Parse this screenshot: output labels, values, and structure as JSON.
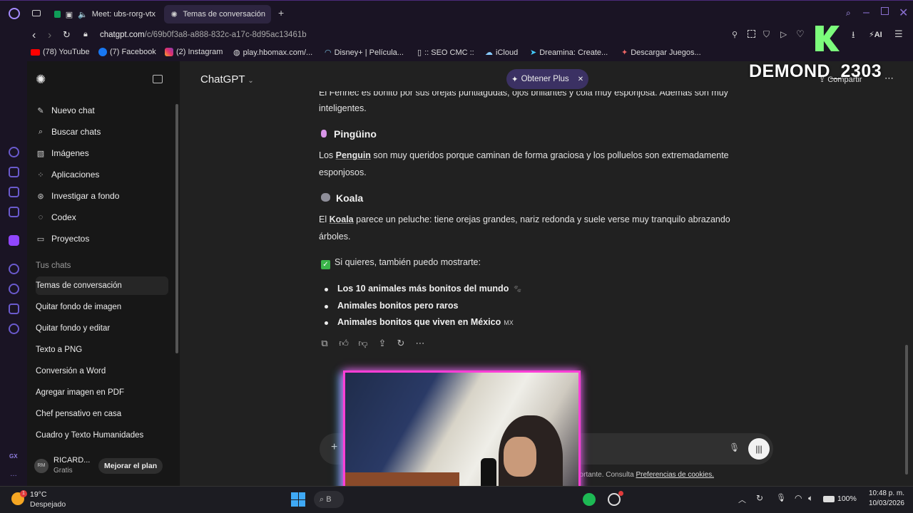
{
  "browser": {
    "tabs": [
      {
        "label": "Meet: ubs-rorg-vtx"
      },
      {
        "label": "Temas de conversación"
      }
    ],
    "url_host": "chatgpt.com",
    "url_path": "/c/69b0f3a8-a888-832c-a17c-8d95ac13461b",
    "ai_label": "AI",
    "bookmarks": [
      {
        "label": "(78) YouTube"
      },
      {
        "label": "(7) Facebook"
      },
      {
        "label": "(2) Instagram"
      },
      {
        "label": "play.hbomax.com/..."
      },
      {
        "label": "Disney+ | Película..."
      },
      {
        "label": ":: SEO CMC ::"
      },
      {
        "label": "iCloud"
      },
      {
        "label": "Dreamina: Create..."
      },
      {
        "label": "Descargar Juegos..."
      }
    ]
  },
  "overlay": {
    "streamer_name": "DEMOND_2303"
  },
  "sidebar": {
    "nav": [
      {
        "label": "Nuevo chat",
        "icon": "edit-icon"
      },
      {
        "label": "Buscar chats",
        "icon": "search-icon"
      },
      {
        "label": "Imágenes",
        "icon": "image-icon"
      },
      {
        "label": "Aplicaciones",
        "icon": "apps-icon"
      },
      {
        "label": "Investigar a fondo",
        "icon": "research-icon"
      },
      {
        "label": "Codex",
        "icon": "codex-icon"
      },
      {
        "label": "Proyectos",
        "icon": "folder-icon"
      }
    ],
    "section_title": "Tus chats",
    "chats": [
      {
        "label": "Temas de conversación"
      },
      {
        "label": "Quitar fondo de imagen"
      },
      {
        "label": "Quitar fondo y editar"
      },
      {
        "label": "Texto a PNG"
      },
      {
        "label": "Conversión a Word"
      },
      {
        "label": "Agregar imagen en PDF"
      },
      {
        "label": "Chef pensativo en casa"
      },
      {
        "label": "Cuadro y Texto Humanidades"
      }
    ],
    "user": {
      "initials": "RM",
      "name": "RICARD...",
      "plan": "Gratis",
      "upgrade_label": "Mejorar el plan"
    }
  },
  "header": {
    "model_label": "ChatGPT",
    "plus_label": "Obtener Plus",
    "share_label": "Compartir"
  },
  "message": {
    "partial_line": "El Fennec es bonito por sus orejas puntiagudas, ojos brillantes y cola muy esponjosa. Además son muy",
    "partial_line2": "inteligentes.",
    "penguin_title": "Pingüino",
    "penguin_pre": "Los ",
    "penguin_bold": "Penguin",
    "penguin_text": " son muy queridos porque caminan de forma graciosa y los polluelos son extremadamente",
    "penguin_text2": "esponjosos.",
    "koala_title": "Koala",
    "koala_pre": "El ",
    "koala_bold": "Koala",
    "koala_text": " parece un peluche: tiene orejas grandes, nariz redonda y suele verse muy tranquilo abrazando",
    "koala_text2": "árboles.",
    "cta": "Si quieres, también puedo mostrarte:",
    "list": [
      "Los 10 animales más bonitos del mundo",
      "Animales bonitos pero raros",
      "Animales bonitos que viven en México"
    ],
    "mx_badge": "MX"
  },
  "footer": {
    "disclaimer": "portante. Consulta ",
    "cookies_link": "Preferencias de cookies."
  },
  "taskbar": {
    "temperature": "19°C",
    "weather": "Despejado",
    "search_placeholder": "B",
    "battery": "100%",
    "time": "10:48 p. m.",
    "date": "10/03/2026"
  }
}
